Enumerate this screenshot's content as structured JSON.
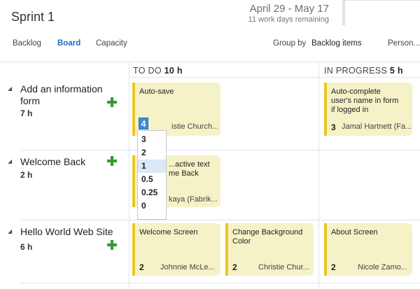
{
  "header": {
    "sprint_title": "Sprint 1",
    "date_range": "April 29 - May 17",
    "work_days": "11 work days remaining"
  },
  "nav": {
    "tabs": [
      {
        "label": "Backlog"
      },
      {
        "label": "Board"
      },
      {
        "label": "Capacity"
      }
    ],
    "active_tab": "Board",
    "group_by_label": "Group by",
    "group_by_value": "Backlog items",
    "person_filter": "Person..."
  },
  "columns": {
    "todo": {
      "label": "TO DO",
      "hours": "10 h"
    },
    "in_progress": {
      "label": "IN PROGRESS",
      "hours": "5 h"
    }
  },
  "rows": [
    {
      "title_line1": "Add an information",
      "title_line2": "form",
      "hours": "7 h",
      "todo_card": {
        "title": "Auto-save",
        "assignee": "istie Church..."
      },
      "inprogress_card": {
        "title_line1": "Auto-complete",
        "title_line2": "user's name in form",
        "title_line3": "if logged in",
        "remaining": "3",
        "assignee": "Jamal Hartnett   (Fa..."
      }
    },
    {
      "title": "Welcome Back",
      "hours": "2 h",
      "todo_card": {
        "title_line1": "...active text",
        "title_line2": "me Back",
        "assignee": "kaya (Fabrik..."
      }
    },
    {
      "title": "Hello World Web Site",
      "hours": "6 h",
      "todo_cards": [
        {
          "title": "Welcome Screen",
          "remaining": "2",
          "assignee": "Johnnie McLe..."
        },
        {
          "title_line1": "Change Background",
          "title_line2": "Color",
          "remaining": "2",
          "assignee": "Christie Chur..."
        }
      ],
      "inprogress_card": {
        "title": "About Screen",
        "remaining": "2",
        "assignee": "Nicole Zamo..."
      }
    }
  ],
  "dropdown": {
    "current_value": "4",
    "options": [
      "3",
      "2",
      "1",
      "0.5",
      "0.25",
      "0"
    ],
    "highlighted": "1"
  },
  "colors": {
    "accent": "#1e6cc8",
    "card_background": "#f5f2c8",
    "card_stripe": "#ecc524",
    "add_icon": "#339933"
  }
}
